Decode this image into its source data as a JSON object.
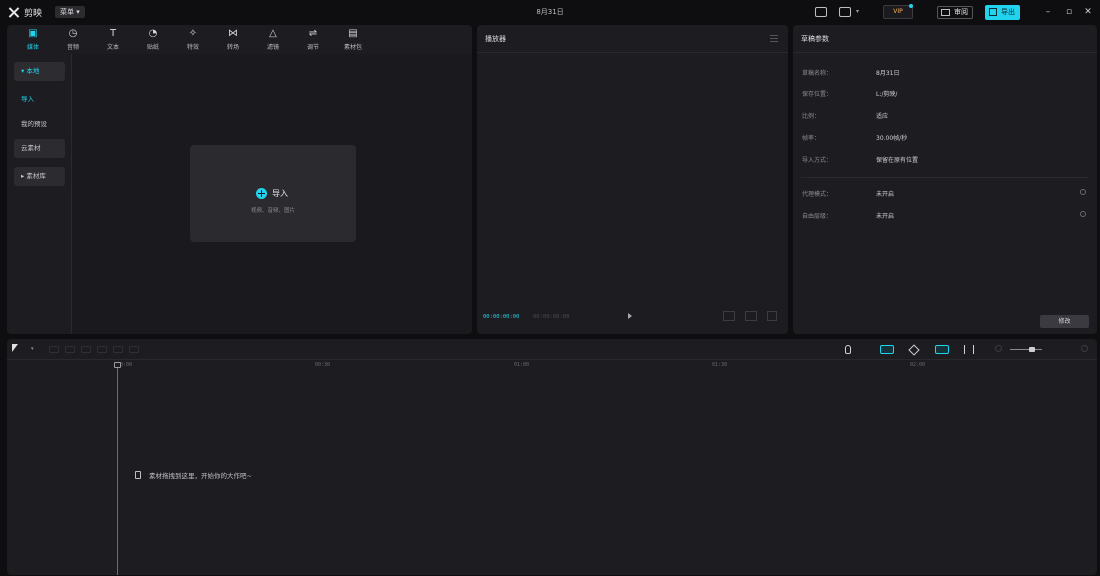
{
  "app": {
    "name": "剪映",
    "menu_label": "菜单 ▾",
    "project_title": "8月31日"
  },
  "titlebar": {
    "pro_label": "VIP",
    "share_label": "审阅",
    "export_label": "导出"
  },
  "tool_tabs": [
    {
      "label": "媒体",
      "icon": "media-icon",
      "glyph": "▣",
      "active": true
    },
    {
      "label": "音频",
      "icon": "audio-icon",
      "glyph": "◷",
      "active": false
    },
    {
      "label": "文本",
      "icon": "text-icon",
      "glyph": "T",
      "active": false
    },
    {
      "label": "贴纸",
      "icon": "sticker-icon",
      "glyph": "◔",
      "active": false
    },
    {
      "label": "特效",
      "icon": "effects-icon",
      "glyph": "✧",
      "active": false
    },
    {
      "label": "转场",
      "icon": "transition-icon",
      "glyph": "⋈",
      "active": false
    },
    {
      "label": "滤镜",
      "icon": "filter-icon",
      "glyph": "△",
      "active": false
    },
    {
      "label": "调节",
      "icon": "adjust-icon",
      "glyph": "⇌",
      "active": false
    },
    {
      "label": "素材包",
      "icon": "package-icon",
      "glyph": "▤",
      "active": false
    }
  ],
  "media_sidebar": [
    {
      "label": "▾ 本地",
      "state": "active"
    },
    {
      "label": "导入",
      "state": "blue"
    },
    {
      "label": "我的预设",
      "state": "plain"
    },
    {
      "label": "云素材",
      "state": "btnlike"
    },
    {
      "label": "▸ 素材库",
      "state": "btnlike"
    }
  ],
  "import_area": {
    "label": "导入",
    "hint": "视频、音频、图片"
  },
  "player": {
    "title": "播放器",
    "timecode_current": "00:00:00:00",
    "timecode_total": "00:00:00:00"
  },
  "properties": {
    "title": "草稿参数",
    "rows": [
      {
        "key": "草稿名称：",
        "value": "8月31日"
      },
      {
        "key": "保存位置：",
        "value": "L:/剪映/"
      },
      {
        "key": "比例：",
        "value": "适应"
      },
      {
        "key": "帧率：",
        "value": "30.00帧/秒"
      },
      {
        "key": "导入方式：",
        "value": "保留在原有位置"
      }
    ],
    "rows2": [
      {
        "key": "代理模式：",
        "value": "未开启"
      },
      {
        "key": "自由层级：",
        "value": "未开启"
      }
    ],
    "modify_label": "修改"
  },
  "timeline": {
    "ruler_ticks": [
      "00:00",
      "00:30",
      "01:00",
      "01:30",
      "02:00"
    ],
    "drop_hint": "素材拖拽到这里，开始你的大作吧~"
  }
}
